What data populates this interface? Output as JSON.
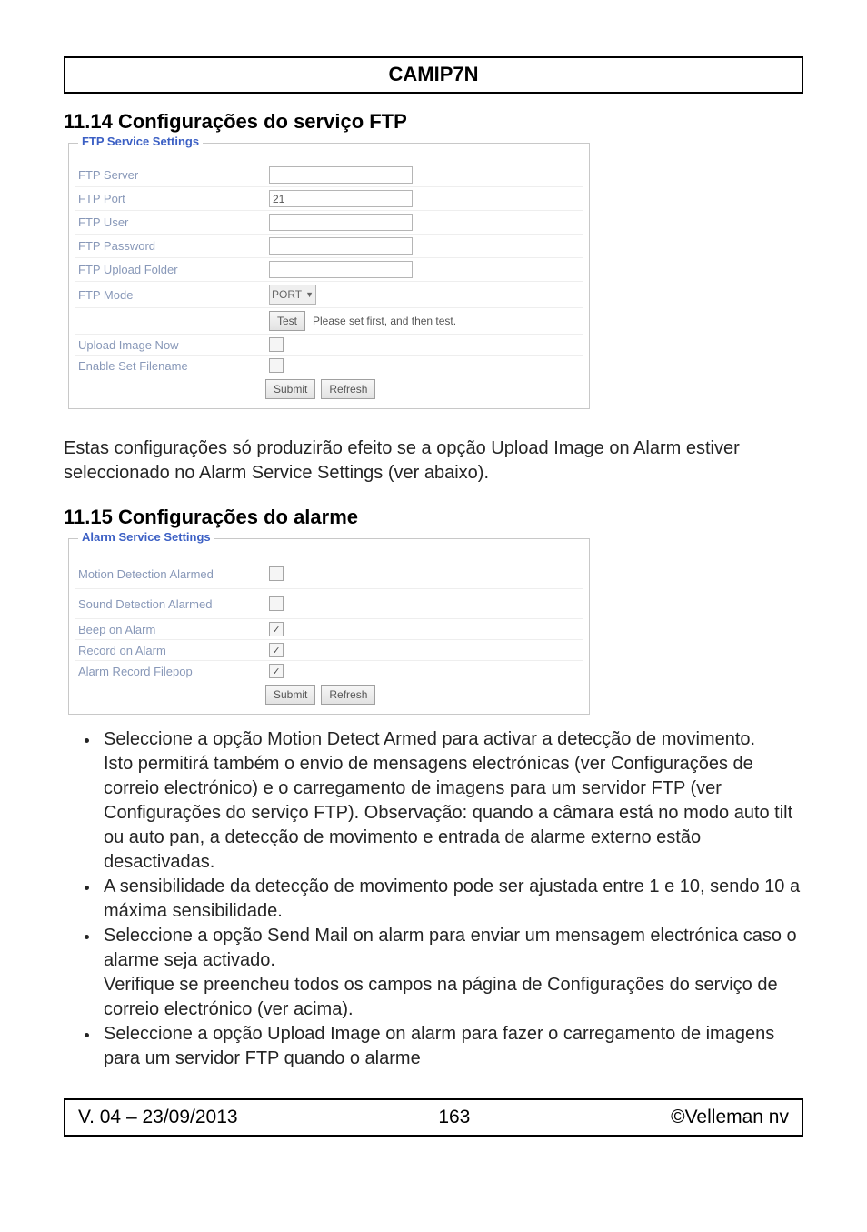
{
  "header": {
    "product": "CAMIP7N"
  },
  "section1": {
    "heading": "11.14 Configurações do serviço FTP"
  },
  "ftpPanel": {
    "legend": "FTP Service Settings",
    "rows": {
      "server_label": "FTP Server",
      "server_value": "",
      "port_label": "FTP Port",
      "port_value": "21",
      "user_label": "FTP User",
      "user_value": "",
      "password_label": "FTP Password",
      "password_value": "",
      "folder_label": "FTP Upload Folder",
      "folder_value": "",
      "mode_label": "FTP Mode",
      "mode_value": "PORT",
      "test_btn": "Test",
      "test_hint": "Please set first, and then test.",
      "upload_now_label": "Upload Image Now",
      "enable_filename_label": "Enable Set Filename"
    },
    "buttons": {
      "submit": "Submit",
      "refresh": "Refresh"
    }
  },
  "paragraph1": "Estas configurações só produzirão efeito se a opção Upload Image on Alarm estiver seleccionado no Alarm Service Settings (ver abaixo).",
  "section2": {
    "heading": "11.15 Configurações do alarme"
  },
  "alarmPanel": {
    "legend": "Alarm Service Settings",
    "rows": {
      "motion_label": "Motion Detection Alarmed",
      "sound_label": "Sound Detection Alarmed",
      "beep_label": "Beep on Alarm",
      "record_label": "Record on Alarm",
      "filepop_label": "Alarm Record Filepop"
    },
    "buttons": {
      "submit": "Submit",
      "refresh": "Refresh"
    }
  },
  "bullets": {
    "b1a": "Seleccione a opção Motion Detect Armed para activar a detecção de movimento.",
    "b1b": "Isto permitirá também o envio de mensagens electrónicas (ver Configurações de correio electrónico) e o carregamento de imagens para um servidor FTP (ver Configurações do serviço FTP). Observação: quando a câmara está no modo auto tilt ou auto pan, a detecção de movimento e entrada de alarme externo estão desactivadas.",
    "b2": "A sensibilidade da detecção de movimento pode ser ajustada entre 1 e 10, sendo 10 a máxima sensibilidade.",
    "b3a": "Seleccione a opção Send Mail on alarm para enviar um mensagem electrónica caso o alarme seja activado.",
    "b3b": "Verifique se preencheu todos os campos na página de Configurações do serviço de correio electrónico (ver acima).",
    "b4": "Seleccione a opção Upload Image on alarm para fazer o carregamento de imagens para um servidor FTP quando o alarme"
  },
  "footer": {
    "version": "V. 04 – 23/09/2013",
    "page": "163",
    "copyright": "©Velleman nv"
  }
}
